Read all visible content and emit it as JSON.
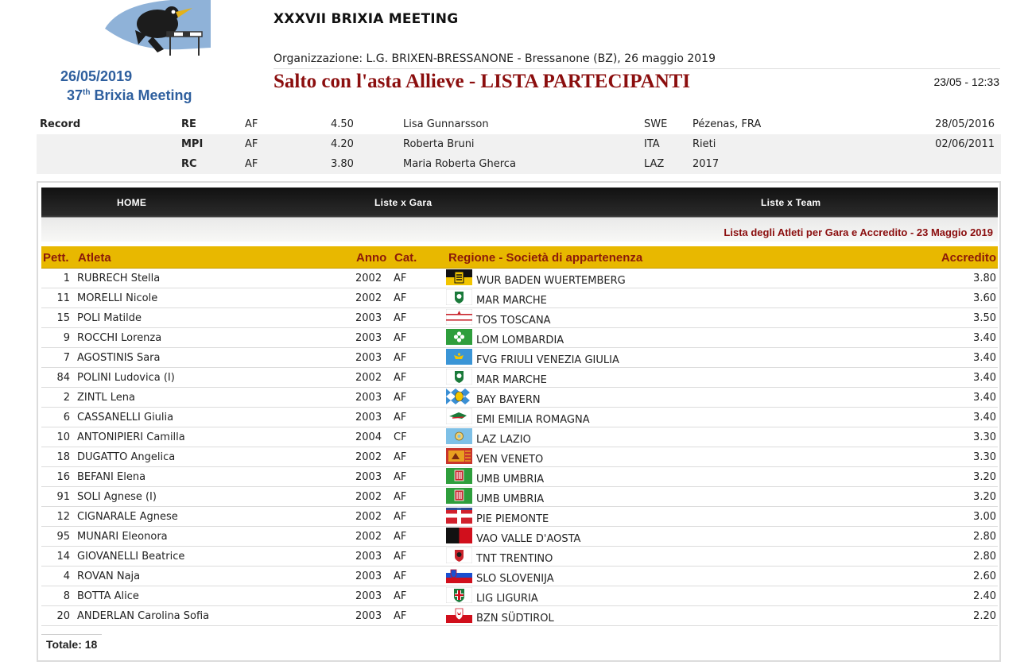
{
  "header": {
    "logo_date": "26/05/2019",
    "logo_title_num": "37",
    "logo_title_sup": "th",
    "logo_title_rest": " Brixia Meeting",
    "meeting": "XXXVII BRIXIA MEETING",
    "organization": "Organizzazione: L.G. BRIXEN-BRESSANONE - Bressanone (BZ), 26 maggio 2019",
    "event_title": "Salto con l'asta Allieve - LISTA PARTECIPANTI",
    "timestamp": "23/05 - 12:33"
  },
  "records": {
    "label": "Record",
    "rows": [
      {
        "code": "RE",
        "cat": "AF",
        "mark": "4.50",
        "name": "Lisa Gunnarsson",
        "nat": "SWE",
        "place": "Pézenas, FRA",
        "date": "28/05/2016"
      },
      {
        "code": "MPI",
        "cat": "AF",
        "mark": "4.20",
        "name": "Roberta Bruni",
        "nat": "ITA",
        "place": "Rieti",
        "date": "02/06/2011"
      },
      {
        "code": "RC",
        "cat": "AF",
        "mark": "3.80",
        "name": "Maria Roberta Gherca",
        "nat": "LAZ",
        "place": "2017",
        "date": ""
      }
    ]
  },
  "nav": {
    "home": "HOME",
    "gara": "Liste x Gara",
    "team": "Liste x Team"
  },
  "subtitle": "Lista degli Atleti per Gara e Accredito - 23 Maggio 2019",
  "table": {
    "headers": {
      "pett": "Pett.",
      "atleta": "Atleta",
      "anno": "Anno",
      "cat": "Cat.",
      "regione": "Regione - Società di appartenenza",
      "accredito": "Accredito"
    },
    "rows": [
      {
        "pett": "1",
        "atleta": "RUBRECH Stella",
        "anno": "2002",
        "cat": "AF",
        "flag": "wur-flag",
        "regione": "WUR BADEN WUERTEMBERG",
        "accredito": "3.80"
      },
      {
        "pett": "11",
        "atleta": "MORELLI Nicole",
        "anno": "2002",
        "cat": "AF",
        "flag": "mar-flag",
        "regione": "MAR MARCHE",
        "accredito": "3.60"
      },
      {
        "pett": "15",
        "atleta": "POLI Matilde",
        "anno": "2003",
        "cat": "AF",
        "flag": "tos-flag",
        "regione": "TOS TOSCANA",
        "accredito": "3.50"
      },
      {
        "pett": "9",
        "atleta": "ROCCHI Lorenza",
        "anno": "2003",
        "cat": "AF",
        "flag": "lom-flag",
        "regione": "LOM LOMBARDIA",
        "accredito": "3.40"
      },
      {
        "pett": "7",
        "atleta": "AGOSTINIS Sara",
        "anno": "2003",
        "cat": "AF",
        "flag": "fvg-flag",
        "regione": "FVG FRIULI VENEZIA GIULIA",
        "accredito": "3.40"
      },
      {
        "pett": "84",
        "atleta": "POLINI Ludovica (I)",
        "anno": "2002",
        "cat": "AF",
        "flag": "mar-flag",
        "regione": "MAR MARCHE",
        "accredito": "3.40"
      },
      {
        "pett": "2",
        "atleta": "ZINTL Lena",
        "anno": "2003",
        "cat": "AF",
        "flag": "bay-flag",
        "regione": "BAY BAYERN",
        "accredito": "3.40"
      },
      {
        "pett": "6",
        "atleta": "CASSANELLI Giulia",
        "anno": "2003",
        "cat": "AF",
        "flag": "emi-flag",
        "regione": "EMI EMILIA ROMAGNA",
        "accredito": "3.40"
      },
      {
        "pett": "10",
        "atleta": "ANTONIPIERI Camilla",
        "anno": "2004",
        "cat": "CF",
        "flag": "laz-flag",
        "regione": "LAZ LAZIO",
        "accredito": "3.30"
      },
      {
        "pett": "18",
        "atleta": "DUGATTO Angelica",
        "anno": "2002",
        "cat": "AF",
        "flag": "ven-flag",
        "regione": "VEN VENETO",
        "accredito": "3.30"
      },
      {
        "pett": "16",
        "atleta": "BEFANI Elena",
        "anno": "2003",
        "cat": "AF",
        "flag": "umb-flag",
        "regione": "UMB UMBRIA",
        "accredito": "3.20"
      },
      {
        "pett": "91",
        "atleta": "SOLI Agnese (I)",
        "anno": "2002",
        "cat": "AF",
        "flag": "umb-flag",
        "regione": "UMB UMBRIA",
        "accredito": "3.20"
      },
      {
        "pett": "12",
        "atleta": "CIGNARALE Agnese",
        "anno": "2002",
        "cat": "AF",
        "flag": "pie-flag",
        "regione": "PIE PIEMONTE",
        "accredito": "3.00"
      },
      {
        "pett": "95",
        "atleta": "MUNARI Eleonora",
        "anno": "2002",
        "cat": "AF",
        "flag": "vao-flag",
        "regione": "VAO VALLE D'AOSTA",
        "accredito": "2.80"
      },
      {
        "pett": "14",
        "atleta": "GIOVANELLI Beatrice",
        "anno": "2003",
        "cat": "AF",
        "flag": "tnt-flag",
        "regione": "TNT TRENTINO",
        "accredito": "2.80"
      },
      {
        "pett": "4",
        "atleta": "ROVAN Naja",
        "anno": "2003",
        "cat": "AF",
        "flag": "slo-flag",
        "regione": "SLO SLOVENIJA",
        "accredito": "2.60"
      },
      {
        "pett": "8",
        "atleta": "BOTTA Alice",
        "anno": "2003",
        "cat": "AF",
        "flag": "lig-flag",
        "regione": "LIG LIGURIA",
        "accredito": "2.40"
      },
      {
        "pett": "20",
        "atleta": "ANDERLAN Carolina Sofia",
        "anno": "2003",
        "cat": "AF",
        "flag": "bzn-flag",
        "regione": "BZN SÜDTIROL",
        "accredito": "2.20"
      }
    ]
  },
  "total": "Totale: 18",
  "colors": {
    "accent_red": "#8b0e0e",
    "header_gold": "#e8b800",
    "logo_blue": "#2e5f9e"
  }
}
